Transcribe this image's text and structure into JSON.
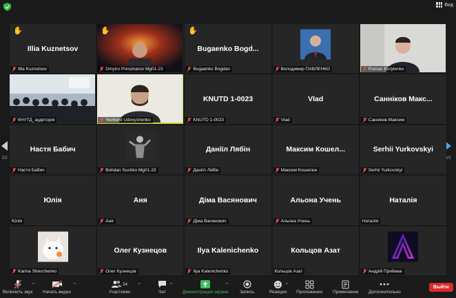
{
  "top": {
    "view_label": "Вид"
  },
  "colors": {
    "accent_green": "#c6e04a",
    "leave_red": "#d92b2b",
    "share_green": "#3dbd5c",
    "mic_red": "#e34a4a"
  },
  "tiles": [
    {
      "big": "Illia Kuznetsov",
      "tag": "Illia Kuznetsov",
      "hand": true
    },
    {
      "big": "",
      "tag": "Dmytro Ponomarov Mg01-23",
      "hand": true,
      "thumb": "video-cosmic"
    },
    {
      "big": "Bugaenko Bogd...",
      "tag": "Bugaenko Bogdan",
      "hand": true
    },
    {
      "big": "",
      "tag": "Володимир ПАВЛЕНКО",
      "thumb": "avatar-suit"
    },
    {
      "big": "",
      "tag": "Roman Kurylenko",
      "thumb": "video-person"
    },
    {
      "big": "",
      "tag": "КНУТД_аудиторія",
      "thumb": "video-classroom"
    },
    {
      "big": "",
      "tag": "Yevhenii Udovychenko",
      "active": true,
      "thumb": "video-man"
    },
    {
      "big": "KNUTD 1-0023",
      "tag": "KNUTD 1-0023"
    },
    {
      "big": "Vlad",
      "tag": "Vlad"
    },
    {
      "big": "Санніков Макс...",
      "tag": "Санніков Максим"
    },
    {
      "big": "Настя Бабич",
      "tag": "Настя Бабич"
    },
    {
      "big": "",
      "tag": "Bohdan Sushko Mg01-23",
      "thumb": "avatar-dark"
    },
    {
      "big": "Даніїл Лябін",
      "tag": "Даніїл Лябін"
    },
    {
      "big": "Максим Кошел...",
      "tag": "Максим Кошелюк"
    },
    {
      "big": "Serhii Yurkovskyi",
      "tag": "Serhii Yurkovskyi"
    },
    {
      "big": "Юлія",
      "tag": "Юлія",
      "nomic": true
    },
    {
      "big": "Аня",
      "tag": "Аня"
    },
    {
      "big": "Діма Васянович",
      "tag": "Діма Васянович"
    },
    {
      "big": "Альона Учень",
      "tag": "Альона Учень"
    },
    {
      "big": "Наталія",
      "tag": "Наталія",
      "nomic": true
    },
    {
      "big": "",
      "tag": "Karina Shevchenko",
      "thumb": "avatar-cat"
    },
    {
      "big": "Олег Кузнецов",
      "tag": "Олег Кузнецов"
    },
    {
      "big": "Ilya Kalenichenko",
      "tag": "Ilya Kalenichenko"
    },
    {
      "big": "Кольцов Азат",
      "tag": "Кольцов Азат",
      "nomic": true
    },
    {
      "big": "",
      "tag": "Андрій Приймак",
      "thumb": "avatar-letter-a"
    }
  ],
  "pager": {
    "left": "1/2",
    "right": "1/2"
  },
  "toolbar": {
    "mute": "Включить звук",
    "video": "Начать видео",
    "participants": "Участники",
    "participants_count": "34",
    "chat": "Чат",
    "share": "Демонстрация экрана",
    "record": "Запись",
    "reactions": "Реакции",
    "apps": "Приложения",
    "notes": "Примечания",
    "more": "Дополнительно",
    "leave": "Выйти"
  }
}
